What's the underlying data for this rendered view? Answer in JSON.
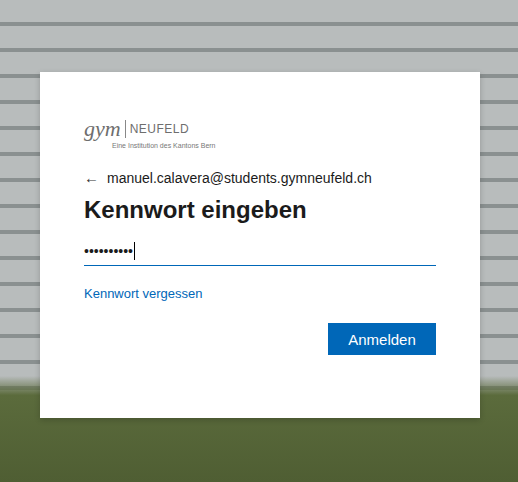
{
  "logo": {
    "mark": "gym",
    "name": "NEUFELD",
    "subtitle": "Eine Institution des Kantons Bern"
  },
  "back": {
    "icon": "←",
    "email": "manuel.calavera@students.gymneufeld.ch"
  },
  "title": "Kennwort eingeben",
  "password": {
    "value": "••••••••••",
    "focused": true
  },
  "forgot_link": "Kennwort vergessen",
  "buttons": [
    {
      "label": "Anmelden",
      "primary": true
    }
  ]
}
